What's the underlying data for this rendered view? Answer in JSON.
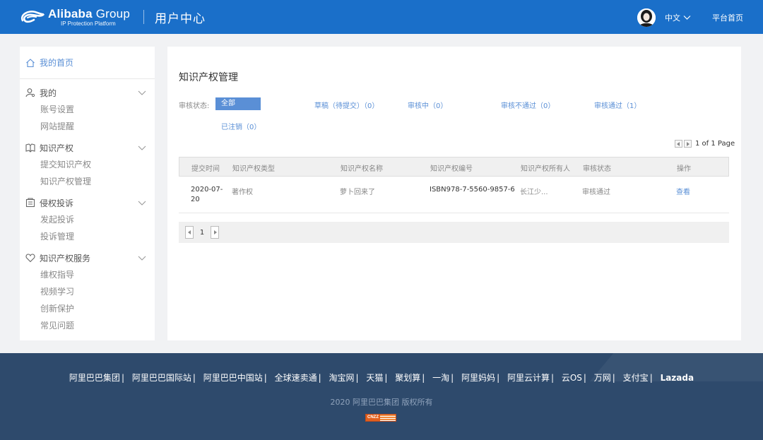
{
  "header": {
    "brand": "Alibaba",
    "brand_suffix": " Group",
    "brand_sub": "IP Protection Platform",
    "title": "用户中心",
    "language": "中文",
    "platform_home": "平台首页",
    "color": "#1a6fc9"
  },
  "sidebar": {
    "home": {
      "label": "我的首页",
      "icon": "home-icon"
    },
    "groups": [
      {
        "label": "我的",
        "icon": "user-settings-icon",
        "items": [
          "账号设置",
          "网站提醒"
        ]
      },
      {
        "label": "知识产权",
        "icon": "book-icon",
        "items": [
          "提交知识产权",
          "知识产权管理"
        ]
      },
      {
        "label": "侵权投诉",
        "icon": "complaint-icon",
        "items": [
          "发起投诉",
          "投诉管理"
        ]
      },
      {
        "label": "知识产权服务",
        "icon": "heart-icon",
        "items": [
          "维权指导",
          "视频学习",
          "创新保护",
          "常见问题"
        ]
      }
    ]
  },
  "main": {
    "title": "知识产权管理",
    "filter_label": "审核状态:",
    "filters": [
      {
        "label": "全部",
        "active": true
      },
      {
        "label": "草稿（待提交）（0）"
      },
      {
        "label": "审核中（0）"
      },
      {
        "label": "审核不通过（0）"
      },
      {
        "label": "审核通过（1）"
      },
      {
        "label": "已注销（0）"
      }
    ],
    "pager_top": "1 of 1 Page",
    "table": {
      "columns": [
        "提交时间",
        "知识产权类型",
        "知识产权名称",
        "知识产权编号",
        "知识产权所有人",
        "审核状态",
        "操作"
      ],
      "rows": [
        {
          "date_line1": "2020-07-",
          "date_line2": "20",
          "type": "著作权",
          "name": "萝卜回来了",
          "number": "ISBN978-7-5560-9857-6",
          "owner": "长江少...",
          "status": "审核通过",
          "action": "查看"
        }
      ]
    },
    "pager_bottom_page": "1"
  },
  "footer": {
    "links": [
      "阿里巴巴集团",
      "阿里巴巴国际站",
      "阿里巴巴中国站",
      "全球速卖通",
      "淘宝网",
      "天猫",
      "聚划算",
      "一淘",
      "阿里妈妈",
      "阿里云计算",
      "云OS",
      "万网",
      "支付宝",
      "Lazada"
    ],
    "separator": "|",
    "copyright": "2020 阿里巴巴集团 版权所有",
    "badge": "CNZZ",
    "color": "#2e4a6c"
  }
}
